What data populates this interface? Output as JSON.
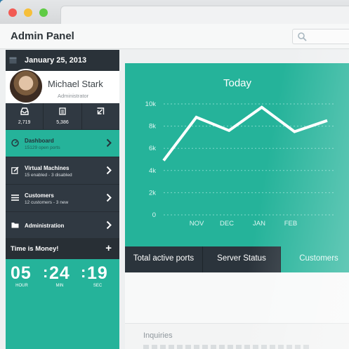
{
  "app": {
    "title": "Admin Panel"
  },
  "search": {
    "icon": "search-icon"
  },
  "sidebar": {
    "date": "January 25, 2013",
    "profile": {
      "name": "Michael Stark",
      "role": "Administrator"
    },
    "stats": [
      {
        "icon": "inbox-icon",
        "value": "2,719"
      },
      {
        "icon": "list-icon",
        "value": "5,386"
      },
      {
        "icon": "export-icon",
        "value": ""
      }
    ],
    "menu": [
      {
        "label": "Dashboard",
        "sub": "15129 open ports",
        "icon": "dashboard-icon",
        "active": true
      },
      {
        "label": "Virtual Machines",
        "sub": "15 enabled - 3 disabled",
        "icon": "edit-icon",
        "active": false
      },
      {
        "label": "Customers",
        "sub": "12 customers - 3 new",
        "icon": "menu-icon",
        "active": false
      },
      {
        "label": "Administration",
        "sub": "",
        "icon": "folder-icon",
        "active": false
      }
    ],
    "time": {
      "title": "Time is Money!",
      "hour": "05",
      "min": "24",
      "sec": "19",
      "hour_label": "HOUR",
      "min_label": "MIN",
      "sec_label": "SEC"
    }
  },
  "chart_data": {
    "type": "line",
    "title": "Today",
    "categories": [
      "",
      "NOV",
      "",
      "DEC",
      "",
      "JAN",
      "",
      "FEB",
      ""
    ],
    "x_labels": [
      "NOV",
      "DEC",
      "JAN",
      "FEB"
    ],
    "values": [
      4.9,
      8.8,
      7.6,
      9.7,
      7.5,
      8.5
    ],
    "y_ticks": [
      "0",
      "2k",
      "4k",
      "6k",
      "8k",
      "10k"
    ],
    "ylim": [
      0,
      10
    ],
    "grid": true,
    "colors": {
      "line": "#ffffff",
      "background": "#25b39a",
      "grid": "#7fd8c9"
    }
  },
  "tabs": [
    {
      "label": "Total active ports",
      "active": false
    },
    {
      "label": "Server Status",
      "active": false
    },
    {
      "label": "Customers",
      "active": true
    }
  ],
  "inquiries": {
    "title": "Inquiries"
  }
}
